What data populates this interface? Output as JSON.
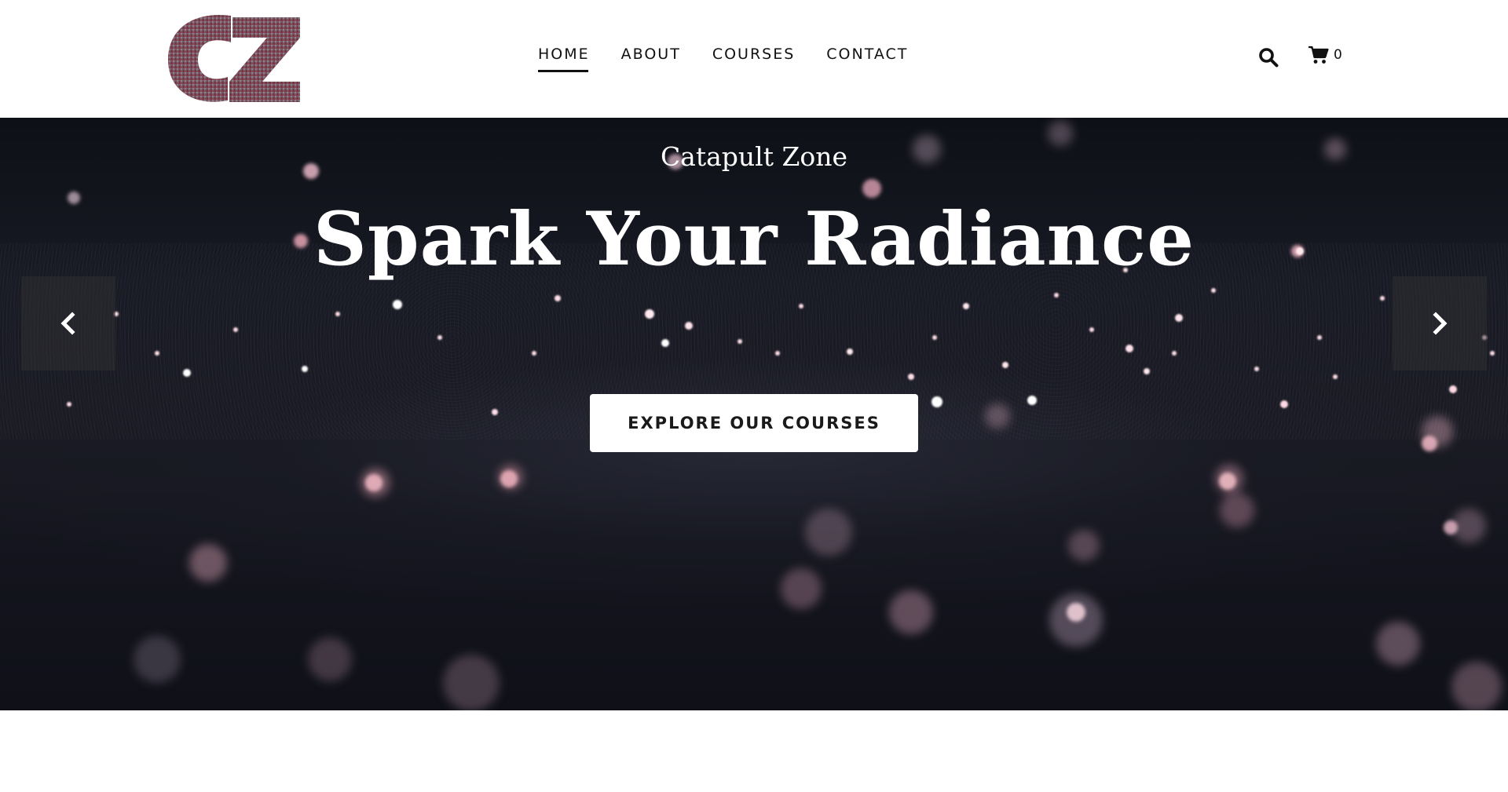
{
  "header": {
    "logo_text": "CZ",
    "nav": [
      {
        "label": "HOME",
        "active": true
      },
      {
        "label": "ABOUT",
        "active": false
      },
      {
        "label": "COURSES",
        "active": false
      },
      {
        "label": "CONTACT",
        "active": false
      }
    ],
    "search_icon": "search-icon",
    "cart_icon": "shopping-cart-icon",
    "cart_count": "0"
  },
  "hero": {
    "subtitle": "Catapult Zone",
    "title": "Spark Your Radiance",
    "cta_label": "EXPLORE OUR COURSES",
    "prev_icon": "chevron-left-icon",
    "next_icon": "chevron-right-icon"
  },
  "colors": {
    "hero_background": "#181a24",
    "bokeh_pink": "#e6a7b4",
    "text_light": "#ffffff",
    "logo_red": "#8a2a3a"
  }
}
